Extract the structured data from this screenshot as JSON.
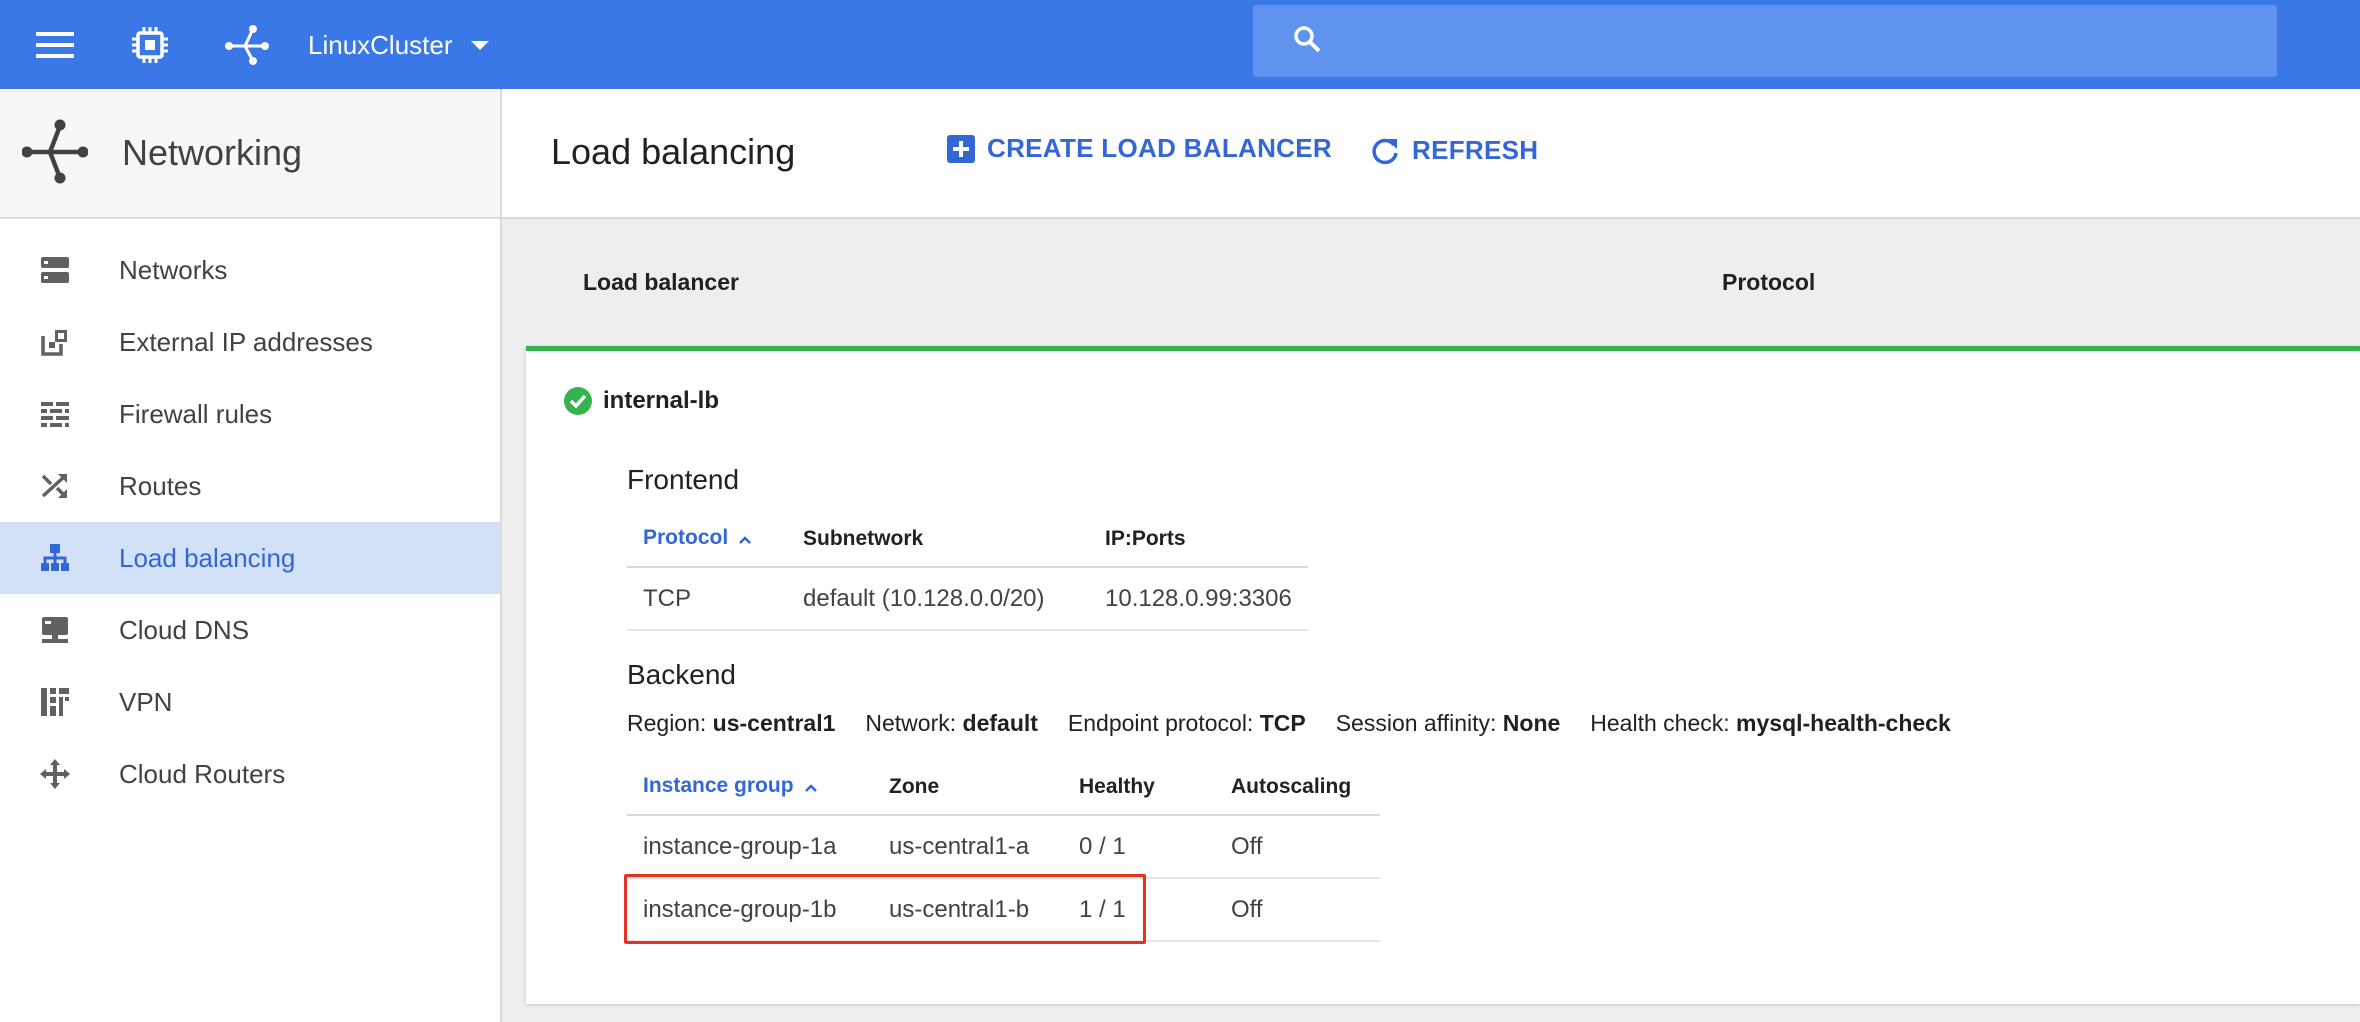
{
  "topbar": {
    "project_name": "LinuxCluster",
    "search_placeholder": ""
  },
  "sidebar": {
    "title": "Networking",
    "items": [
      {
        "label": "Networks",
        "icon": "networks-icon"
      },
      {
        "label": "External IP addresses",
        "icon": "external-ip-icon"
      },
      {
        "label": "Firewall rules",
        "icon": "firewall-icon"
      },
      {
        "label": "Routes",
        "icon": "routes-icon"
      },
      {
        "label": "Load balancing",
        "icon": "load-balancing-icon",
        "active": true
      },
      {
        "label": "Cloud DNS",
        "icon": "cloud-dns-icon"
      },
      {
        "label": "VPN",
        "icon": "vpn-icon"
      },
      {
        "label": "Cloud Routers",
        "icon": "cloud-routers-icon"
      }
    ]
  },
  "header": {
    "title": "Load balancing",
    "create_label": "CREATE LOAD BALANCER",
    "refresh_label": "REFRESH"
  },
  "list": {
    "col_load_balancer": "Load balancer",
    "col_protocol": "Protocol"
  },
  "lb": {
    "name": "internal-lb",
    "frontend": {
      "title": "Frontend",
      "headers": [
        "Protocol",
        "Subnetwork",
        "IP:Ports"
      ],
      "rows": [
        [
          "TCP",
          "default (10.128.0.0/20)",
          "10.128.0.99:3306"
        ]
      ]
    },
    "backend": {
      "title": "Backend",
      "region_label": "Region:",
      "region": "us-central1",
      "network_label": "Network:",
      "network": "default",
      "endpoint_label": "Endpoint protocol:",
      "endpoint": "TCP",
      "affinity_label": "Session affinity:",
      "affinity": "None",
      "health_label": "Health check:",
      "health": "mysql-health-check",
      "headers": [
        "Instance group",
        "Zone",
        "Healthy",
        "Autoscaling"
      ],
      "rows": [
        [
          "instance-group-1a",
          "us-central1-a",
          "0 / 1",
          "Off"
        ],
        [
          "instance-group-1b",
          "us-central1-b",
          "1 / 1",
          "Off"
        ]
      ]
    }
  },
  "colors": {
    "topbar": "#3b78e7",
    "accent": "#3367d6",
    "healthy": "#34b34f",
    "highlight": "#e53322"
  }
}
